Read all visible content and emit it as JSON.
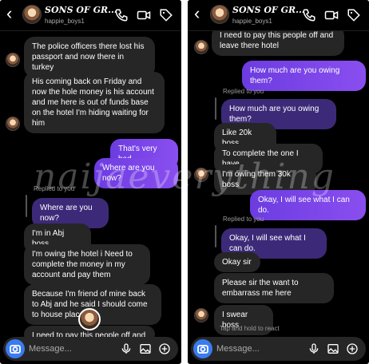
{
  "header": {
    "title": "SONS OF GR...",
    "username": "happie_boys1"
  },
  "composer": {
    "placeholder": "Message..."
  },
  "watermark": "naijaeverything",
  "left": {
    "m1": "The police officers there lost his passport and now there in turkey",
    "m2": "His coming back on Friday and now the hole money is his account and me here is out of funds base on the hotel I'm hiding waiting for him",
    "m3": "That's very bad",
    "m4": "Where are you now?",
    "replied_label": "Replied to you",
    "quoted": "Where are you now?",
    "m5": "I'm in Abj boss",
    "m6": "I'm owing the hotel i Need to complete the money in my account and pay them",
    "m7": "Because I'm friend of mine back to Abj and he said I should come to house place",
    "m8": "I need to pay this people off and"
  },
  "right": {
    "m1": "I need to pay this people off and leave there hotel",
    "m2": "How much are you owing them?",
    "replied_label": "Replied to you",
    "quoted": "How much are you owing them?",
    "m3": "Like 20k boss",
    "m4": "To complete the one I have",
    "m5": "I'm owing them 30k boss",
    "m6": "Okay, I will see what I can do.",
    "replied_label2": "Replied to you",
    "quoted2": "Okay, I will see what I can do.",
    "m7": "Okay sir",
    "m8": "Please sir the want to embarrass me here",
    "m9": "I swear boss",
    "hint": "Tap and hold to react"
  }
}
